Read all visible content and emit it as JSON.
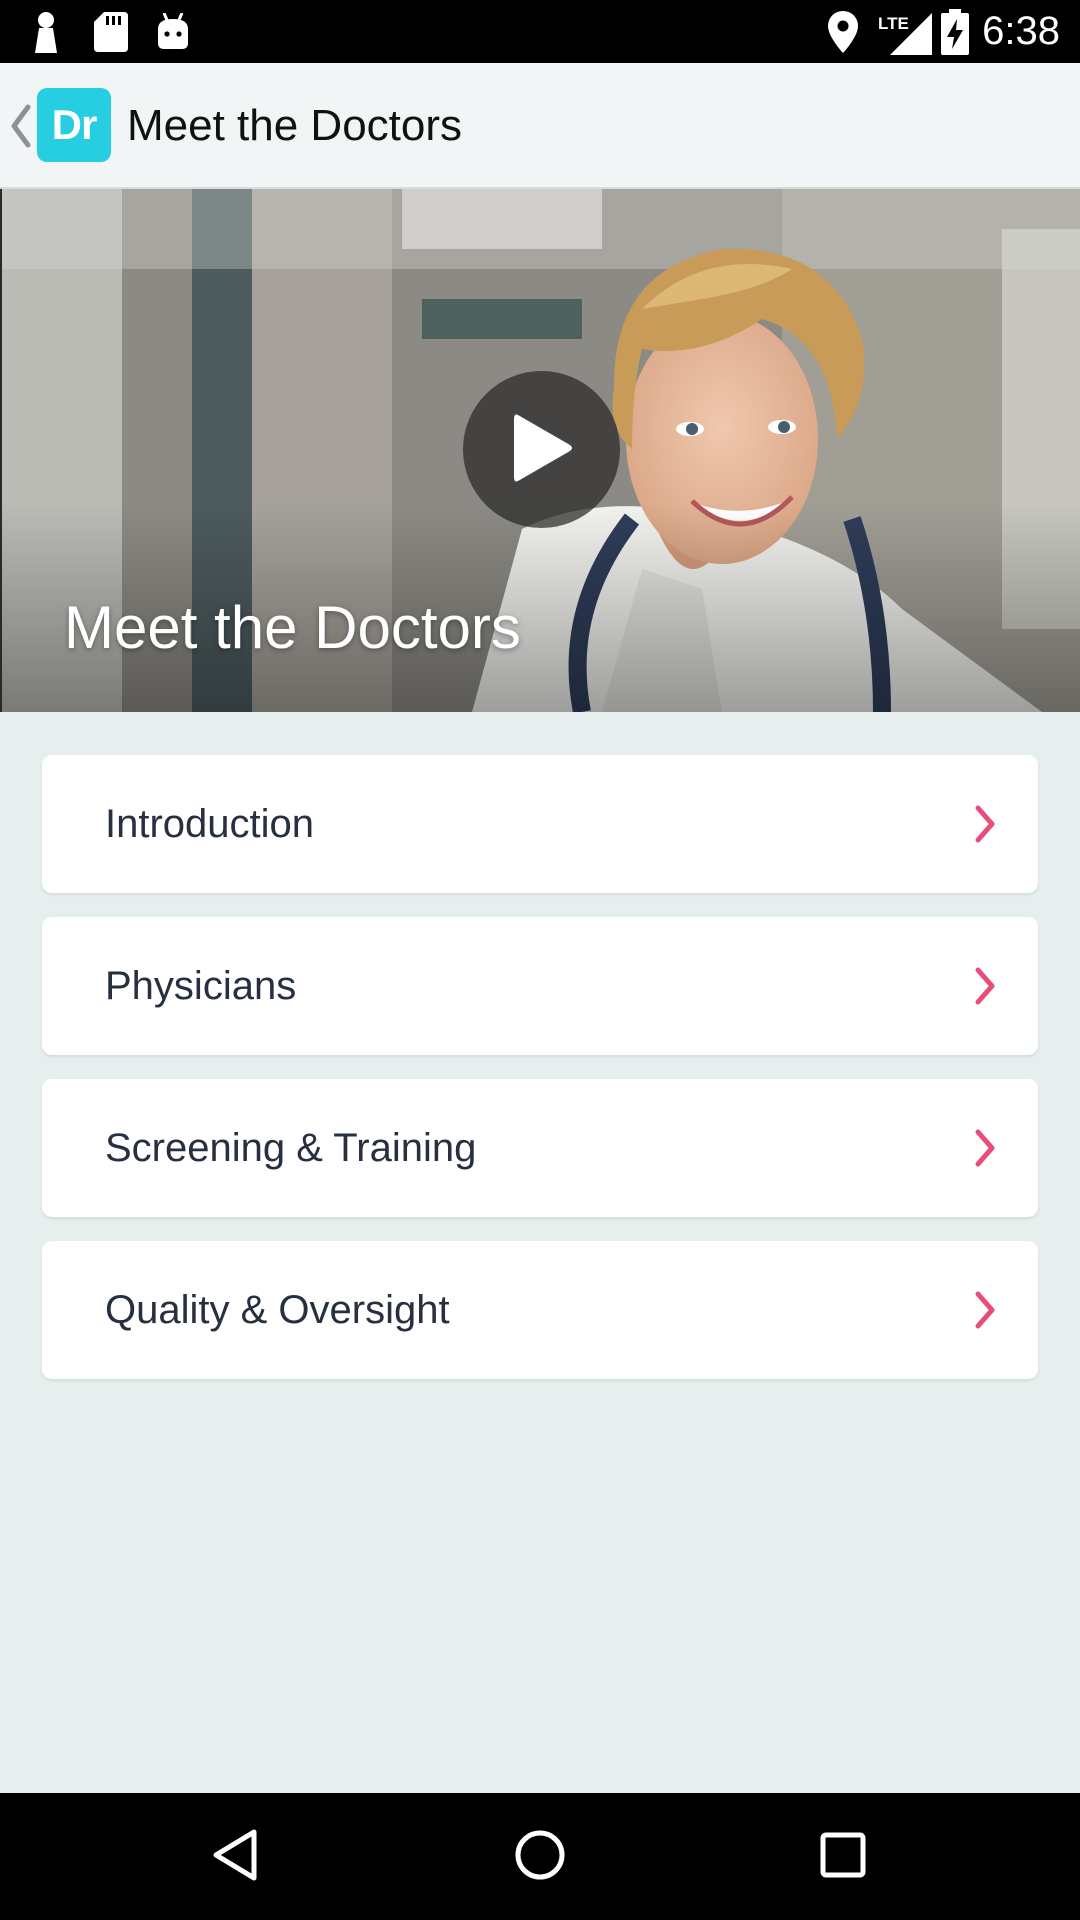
{
  "status_bar": {
    "time": "6:38",
    "left_icons": [
      "keyhole-icon",
      "sd-card-icon",
      "android-icon"
    ],
    "right_icons": [
      "location-icon",
      "lte-signal-icon",
      "battery-charging-icon"
    ],
    "network_label": "LTE"
  },
  "app_bar": {
    "logo_text": "Dr",
    "title": "Meet the Doctors",
    "accent_color": "#27cde0"
  },
  "hero": {
    "title": "Meet the Doctors",
    "play_icon": "play-icon"
  },
  "menu": {
    "chevron_color": "#e84d7a",
    "items": [
      {
        "label": "Introduction"
      },
      {
        "label": "Physicians"
      },
      {
        "label": "Screening & Training"
      },
      {
        "label": "Quality & Oversight"
      }
    ]
  },
  "nav_bar": {
    "buttons": [
      "back-icon",
      "home-icon",
      "recents-icon"
    ]
  }
}
